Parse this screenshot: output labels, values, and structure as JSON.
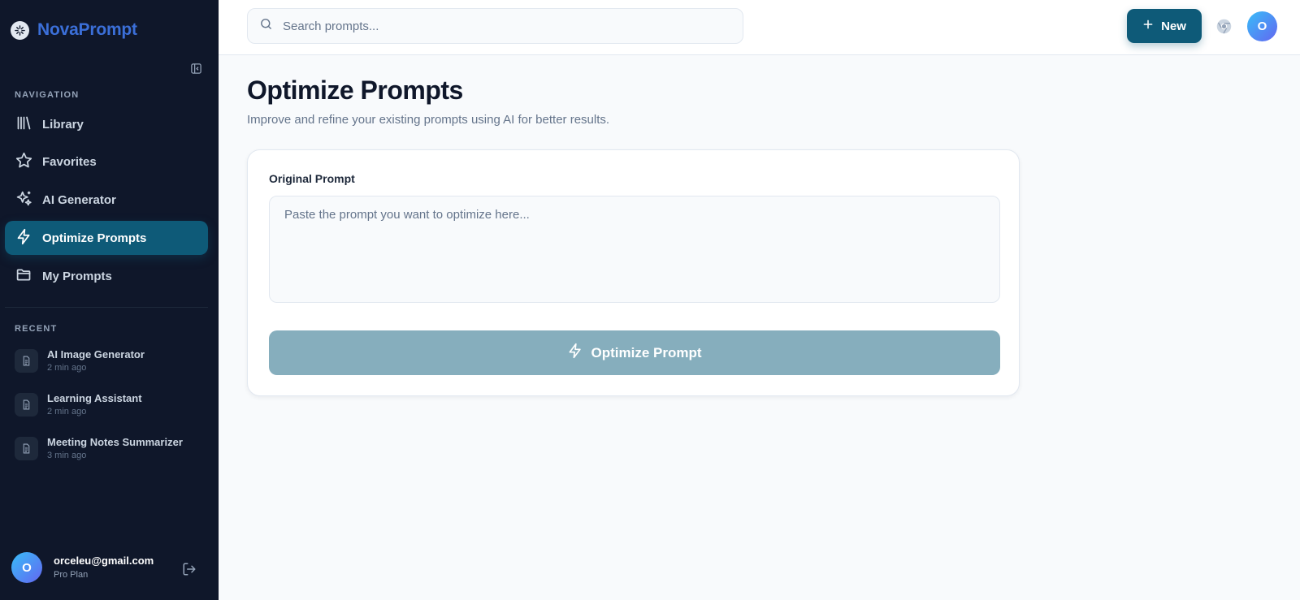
{
  "brand": {
    "name": "NovaPrompt",
    "logo_icon": "sparkle-icon"
  },
  "sidebar": {
    "navigation_label": "NAVIGATION",
    "items": [
      {
        "label": "Library",
        "icon": "library-icon",
        "active": false
      },
      {
        "label": "Favorites",
        "icon": "star-icon",
        "active": false
      },
      {
        "label": "AI Generator",
        "icon": "sparkles-icon",
        "active": false
      },
      {
        "label": "Optimize Prompts",
        "icon": "lightning-icon",
        "active": true
      },
      {
        "label": "My Prompts",
        "icon": "folder-icon",
        "active": false
      }
    ],
    "recent_label": "RECENT",
    "recent": [
      {
        "title": "AI Image Generator",
        "time": "2 min ago"
      },
      {
        "title": "Learning Assistant",
        "time": "2 min ago"
      },
      {
        "title": "Meeting Notes Summarizer",
        "time": "3 min ago"
      }
    ],
    "user": {
      "initial": "O",
      "email": "orceleu@gmail.com",
      "plan": "Pro Plan"
    }
  },
  "header": {
    "search_placeholder": "Search prompts...",
    "new_label": "New",
    "avatar_initial": "O"
  },
  "main": {
    "title": "Optimize Prompts",
    "subtitle": "Improve and refine your existing prompts using AI for better results.",
    "field_label": "Original Prompt",
    "textarea_placeholder": "Paste the prompt you want to optimize here...",
    "button_label": "Optimize Prompt"
  },
  "colors": {
    "accent": "#0e5a78",
    "sidebar_bg": "#0f172a",
    "button_disabled": "#86aebd",
    "brand": "#3b6fd8"
  }
}
